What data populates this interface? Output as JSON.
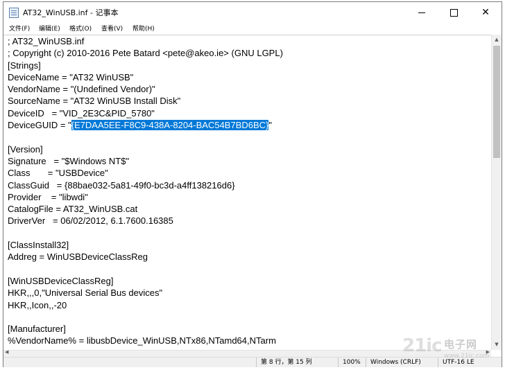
{
  "window": {
    "title": "AT32_WinUSB.inf - 记事本",
    "minimize": "—",
    "maximize": "□",
    "close": "✕"
  },
  "menu": [
    "文件(F)",
    "编辑(E)",
    "格式(O)",
    "查看(V)",
    "帮助(H)"
  ],
  "editor": {
    "before_selection": "; AT32_WinUSB.inf\n; Copyright (c) 2010-2016 Pete Batard <pete@akeo.ie> (GNU LGPL)\n[Strings]\nDeviceName = \"AT32 WinUSB\"\nVendorName = \"(Undefined Vendor)\"\nSourceName = \"AT32 WinUSB Install Disk\"\nDeviceID   = \"VID_2E3C&PID_5780\"\nDeviceGUID = \"",
    "selection": "{E7DAA5EE-F8C9-438A-8204-BAC54B7BD6BC}",
    "after_selection": "\"\n\n[Version]\nSignature   = \"$Windows NT$\"\nClass       = \"USBDevice\"\nClassGuid   = {88bae032-5a81-49f0-bc3d-a4ff138216d6}\nProvider    = \"libwdi\"\nCatalogFile = AT32_WinUSB.cat\nDriverVer   = 06/02/2012, 6.1.7600.16385\n\n[ClassInstall32]\nAddreg = WinUSBDeviceClassReg\n\n[WinUSBDeviceClassReg]\nHKR,,,0,\"Universal Serial Bus devices\"\nHKR,,Icon,,-20\n\n[Manufacturer]\n%VendorName% = libusbDevice_WinUSB,NTx86,NTamd64,NTarm"
  },
  "status": {
    "position": "第 8 行，第 15 列",
    "zoom": "100%",
    "line_ending": "Windows (CRLF)",
    "encoding": "UTF-16 LE"
  },
  "watermark": {
    "logo": "21ic",
    "cn": "电子网",
    "url": "www.21ic.com"
  },
  "icons": {
    "app": "notepad-icon",
    "scroll_up": "scroll-up-arrow-icon",
    "scroll_down": "scroll-down-arrow-icon"
  }
}
